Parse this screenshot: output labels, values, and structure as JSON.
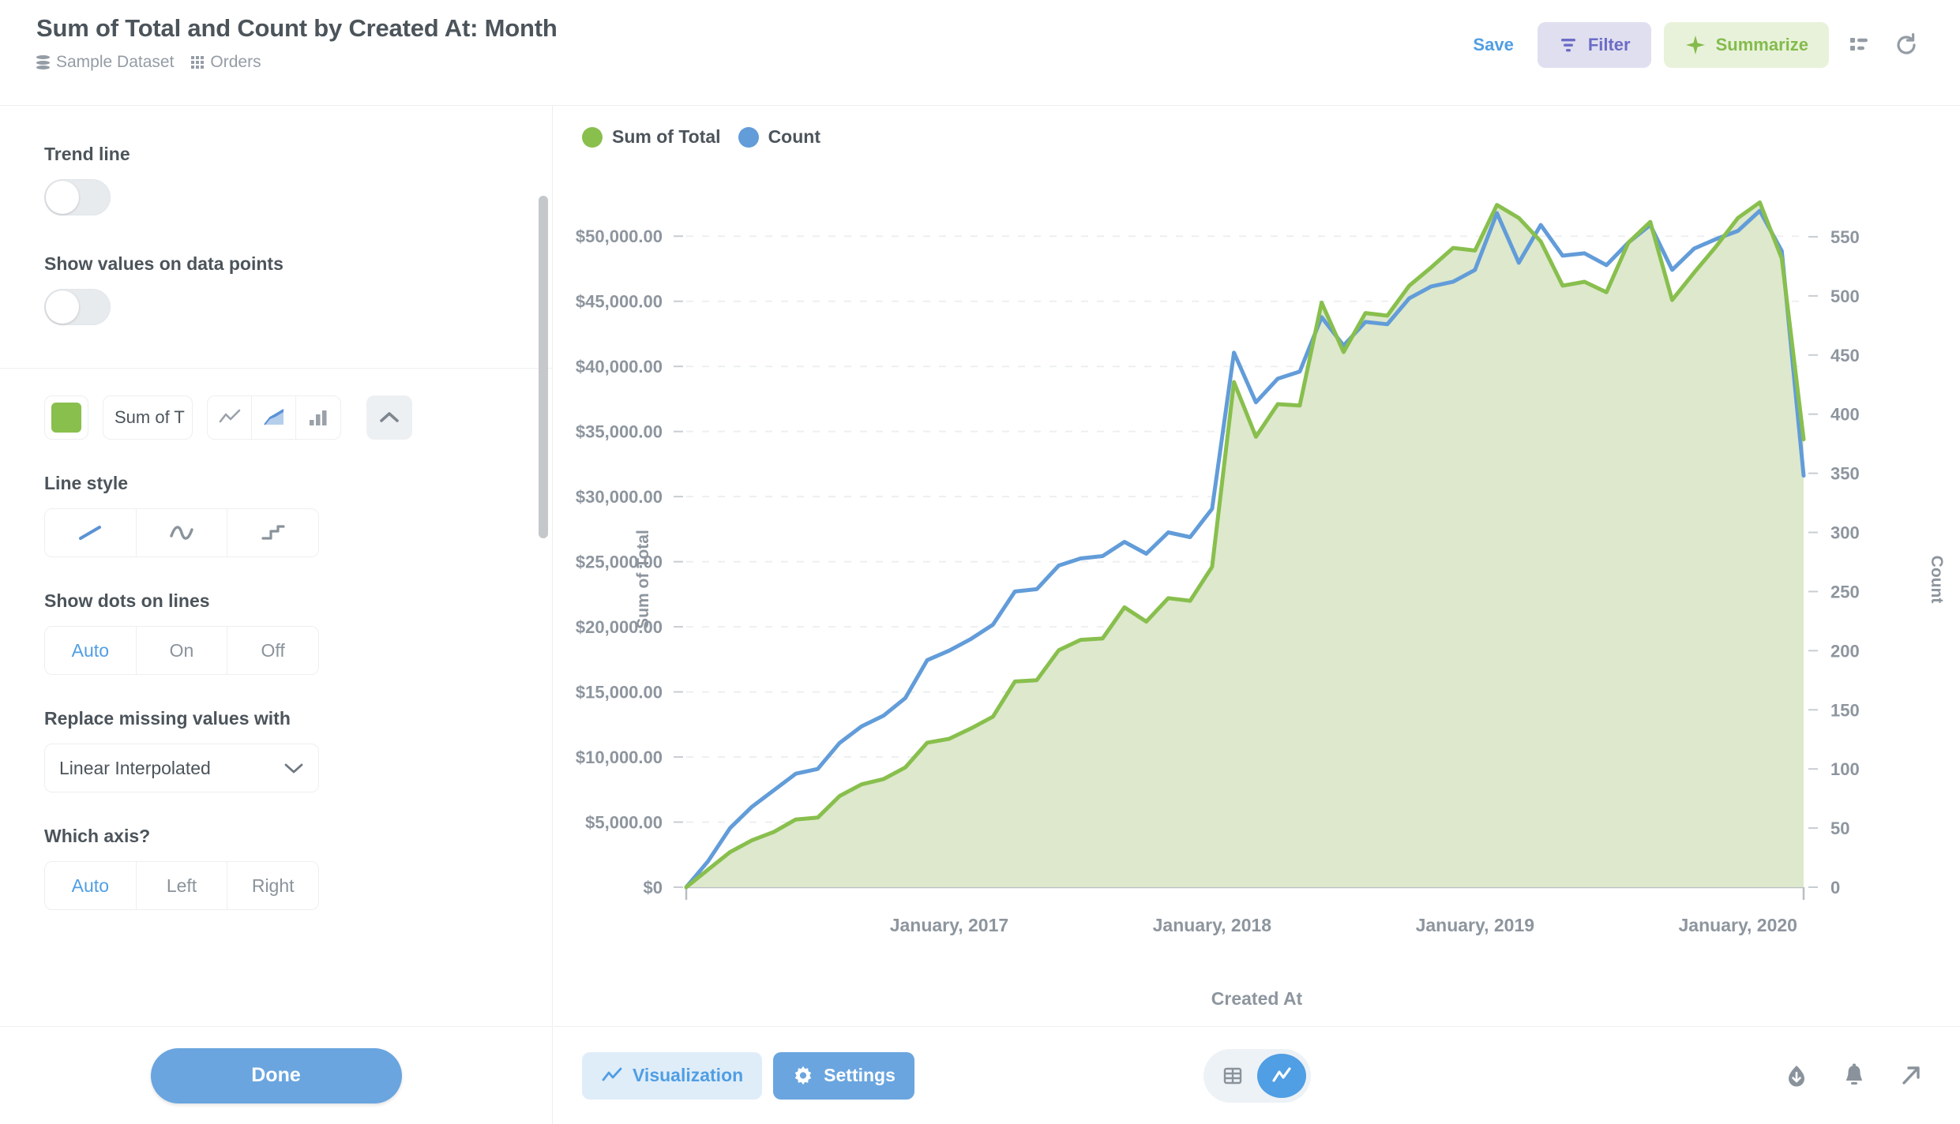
{
  "header": {
    "title": "Sum of Total and Count by Created At: Month",
    "breadcrumb": [
      {
        "icon": "database-icon",
        "label": "Sample Dataset"
      },
      {
        "icon": "table-grid-icon",
        "label": "Orders"
      }
    ],
    "save_label": "Save",
    "filter_label": "Filter",
    "summarize_label": "Summarize",
    "colors": {
      "save": "#509EE3",
      "filter_bg": "#E0DFF0",
      "filter_fg": "#6C6CC6",
      "summarize_bg": "#E8F2DA",
      "summarize_fg": "#84BB4C"
    }
  },
  "sidebar": {
    "trend_line": {
      "label": "Trend line",
      "enabled": false
    },
    "show_values": {
      "label": "Show values on data points",
      "enabled": false
    },
    "series": {
      "color": "#88BF4D",
      "name": "Sum of T",
      "display_types": [
        "line-chart-icon",
        "area-chart-icon",
        "bar-chart-icon"
      ],
      "selected_display": "area-chart-icon",
      "collapse_icon": "chevron-up-icon"
    },
    "line_style": {
      "label": "Line style",
      "options": [
        "linear-line-icon",
        "curve-line-icon",
        "step-line-icon"
      ],
      "selected": "linear-line-icon"
    },
    "show_dots": {
      "label": "Show dots on lines",
      "options": [
        "Auto",
        "On",
        "Off"
      ],
      "selected": "Auto"
    },
    "replace_missing": {
      "label": "Replace missing values with",
      "value": "Linear Interpolated"
    },
    "which_axis": {
      "label": "Which axis?",
      "options": [
        "Auto",
        "Left",
        "Right"
      ],
      "selected": "Auto"
    },
    "done_label": "Done"
  },
  "bottom_bar": {
    "visualization_label": "Visualization",
    "settings_label": "Settings",
    "view_toggle": {
      "options": [
        "table-view-icon",
        "chart-view-icon"
      ],
      "selected": "chart-view-icon"
    },
    "actions": [
      "download-icon",
      "alert-bell-icon",
      "share-arrow-icon"
    ]
  },
  "chart_data": {
    "type": "area",
    "title": "Sum of Total and Count by Created At: Month",
    "xlabel": "Created At",
    "ylabel": "Sum of Total",
    "y2label": "Count",
    "grid": true,
    "legend_position": "top-left",
    "x_tick_labels": [
      "January, 2017",
      "January, 2018",
      "January, 2019",
      "January, 2020"
    ],
    "x_tick_indices": [
      12,
      24,
      36,
      48
    ],
    "ylim": [
      0,
      52500
    ],
    "y_ticks": [
      "$0",
      "$5,000.00",
      "$10,000.00",
      "$15,000.00",
      "$20,000.00",
      "$25,000.00",
      "$30,000.00",
      "$35,000.00",
      "$40,000.00",
      "$45,000.00",
      "$50,000.00"
    ],
    "y_tick_values": [
      0,
      5000,
      10000,
      15000,
      20000,
      25000,
      30000,
      35000,
      40000,
      45000,
      50000
    ],
    "y2lim": [
      0,
      578
    ],
    "y2_ticks": [
      "0",
      "50",
      "100",
      "150",
      "200",
      "250",
      "300",
      "350",
      "400",
      "450",
      "500",
      "550"
    ],
    "y2_tick_values": [
      0,
      50,
      100,
      150,
      200,
      250,
      300,
      350,
      400,
      450,
      500,
      550
    ],
    "series": [
      {
        "name": "Sum of Total",
        "color": "#88BF4D",
        "fill": "#DDE8CC",
        "axis": "left",
        "values": [
          0,
          1350,
          2700,
          3600,
          4250,
          5200,
          5350,
          7000,
          7900,
          8300,
          9200,
          11100,
          11400,
          12200,
          13100,
          15800,
          15900,
          18200,
          19000,
          19100,
          21500,
          20400,
          22200,
          22000,
          24600,
          38800,
          34600,
          37100,
          37000,
          44900,
          41100,
          44100,
          43900,
          46200,
          47600,
          49100,
          48900,
          52400,
          51400,
          49600,
          46200,
          46500,
          45700,
          49500,
          51100,
          45100,
          47200,
          49200,
          51400,
          52600,
          48300,
          34400
        ]
      },
      {
        "name": "Count",
        "color": "#629CD9",
        "axis": "right",
        "values": [
          0,
          22,
          50,
          68,
          82,
          96,
          100,
          122,
          136,
          145,
          160,
          192,
          200,
          210,
          222,
          250,
          252,
          272,
          278,
          280,
          292,
          282,
          300,
          296,
          320,
          452,
          410,
          430,
          436,
          482,
          458,
          478,
          476,
          498,
          508,
          512,
          522,
          570,
          528,
          560,
          534,
          536,
          526,
          545,
          560,
          522,
          540,
          548,
          555,
          572,
          538,
          348
        ]
      }
    ]
  }
}
